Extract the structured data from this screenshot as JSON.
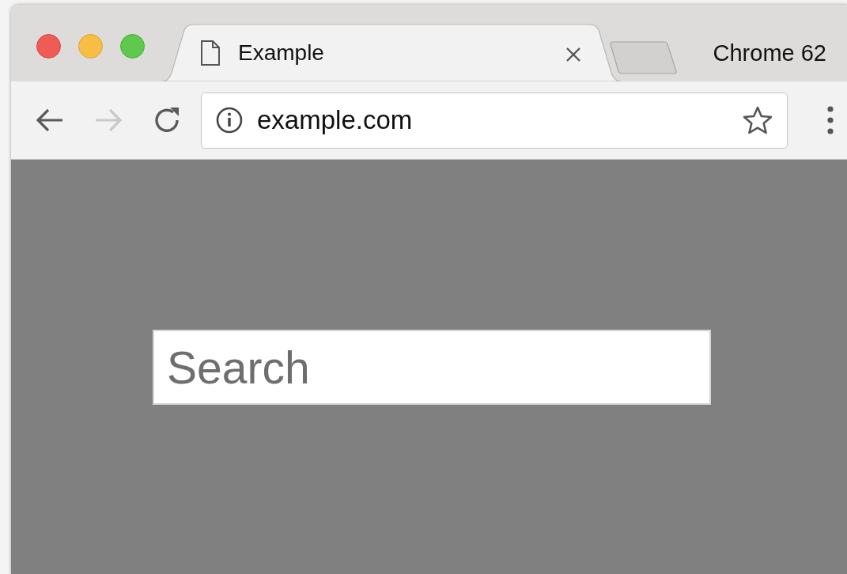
{
  "window": {
    "badge": "Chrome 62"
  },
  "tabs": [
    {
      "title": "Example",
      "selected": true
    }
  ],
  "toolbar": {
    "back_disabled": false,
    "forward_disabled": true
  },
  "address_bar": {
    "value": "example.com"
  },
  "page": {
    "search": {
      "placeholder": "Search"
    }
  }
}
